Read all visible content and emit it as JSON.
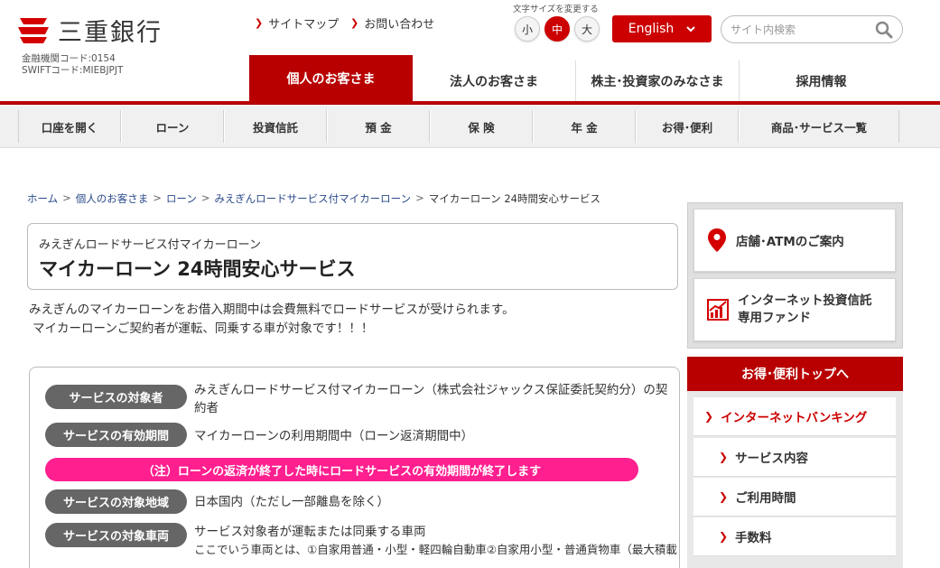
{
  "header": {
    "logo_text": "三重銀行",
    "bank_code_line1": "金融機関コード:0154",
    "bank_code_line2": "SWIFTコード:MIEBJPJT",
    "links": [
      "サイトマップ",
      "お問い合わせ"
    ],
    "font_size_label": "文字サイズを変更する",
    "font_sizes": [
      "小",
      "中",
      "大"
    ],
    "language_label": "English",
    "search_placeholder": "サイト内検索"
  },
  "main_nav": [
    "個人のお客さま",
    "法人のお客さま",
    "株主･投資家のみなさま",
    "採用情報"
  ],
  "sub_nav": [
    "口座を開く",
    "ローン",
    "投資信託",
    "預 金",
    "保 険",
    "年 金",
    "お得･便利",
    "商品･サービス一覧"
  ],
  "breadcrumb": [
    "ホーム",
    "個人のお客さま",
    "ローン",
    "みえぎんロードサービス付マイカーローン",
    "マイカーローン 24時間安心サービス"
  ],
  "title": {
    "sub": "みえぎんロードサービス付マイカーローン",
    "main": "マイカーローン 24時間安心サービス"
  },
  "intro": {
    "line1": "みえぎんのマイカーローンをお借入期間中は会費無料でロードサービスが受けられます。",
    "line2": "マイカーローンご契約者が運転、同乗する車が対象です！！！"
  },
  "info": {
    "target_person_label": "サービスの対象者",
    "target_person_value": "みえぎんロードサービス付マイカーローン（株式会社ジャックス保証委託契約分）の契約者",
    "period_label": "サービスの有効期間",
    "period_value": "マイカーローンの利用期間中（ローン返済期間中）",
    "warning": "（注）ローンの返済が終了した時にロードサービスの有効期間が終了します",
    "area_label": "サービスの対象地域",
    "area_value": "日本国内（ただし一部離島を除く）",
    "vehicle_label": "サービスの対象車両",
    "vehicle_value": "サービス対象者が運転または同乗する車両",
    "vehicle_detail": "ここでいう車両とは、①自家用普通・小型・軽四輪自動車②自家用小型・普通貨物車（最大積載"
  },
  "sidebar": {
    "store_atm": "店舗･ATMのご案内",
    "fund_line1": "インターネット投資信託",
    "fund_line2": "専用ファンド",
    "red_header": "お得･便利トップへ",
    "list": [
      "インターネットバンキング",
      "サービス内容",
      "ご利用時間",
      "手数料"
    ]
  },
  "colors": {
    "brand_red": "#b80000",
    "warning_pink": "#ff1f8f",
    "pill_gray": "#666666"
  }
}
